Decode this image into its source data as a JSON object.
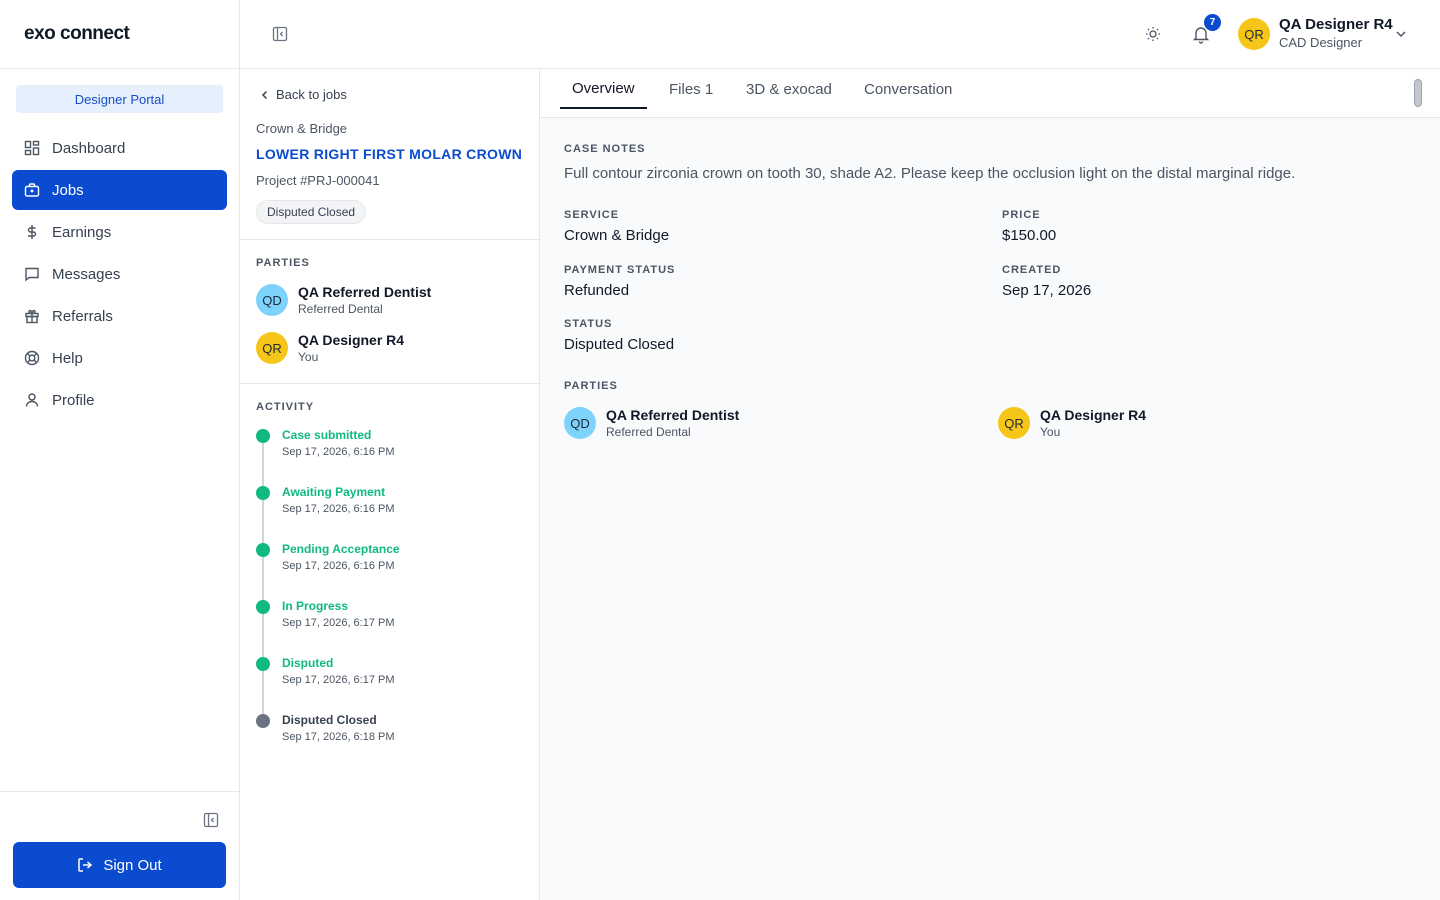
{
  "app": {
    "logo": "exo connect",
    "portal_label": "Designer Portal",
    "sign_out": "Sign Out"
  },
  "nav": [
    {
      "label": "Dashboard",
      "icon": "dashboard-icon",
      "active": false
    },
    {
      "label": "Jobs",
      "icon": "briefcase-icon",
      "active": true
    },
    {
      "label": "Earnings",
      "icon": "dollar-icon",
      "active": false
    },
    {
      "label": "Messages",
      "icon": "message-icon",
      "active": false
    },
    {
      "label": "Referrals",
      "icon": "gift-icon",
      "active": false
    },
    {
      "label": "Help",
      "icon": "lifebuoy-icon",
      "active": false
    },
    {
      "label": "Profile",
      "icon": "user-icon",
      "active": false
    }
  ],
  "header": {
    "notification_count": "7",
    "user_initials": "QR",
    "user_name": "QA Designer R4",
    "user_role": "CAD Designer"
  },
  "job": {
    "back_label": "Back to jobs",
    "category": "Crown & Bridge",
    "title": "LOWER RIGHT FIRST MOLAR CROWN",
    "project": "Project #PRJ-000041",
    "status": "Disputed Closed"
  },
  "parties_label": "PARTIES",
  "parties": [
    {
      "initials": "QD",
      "name": "QA Referred Dentist",
      "sub": "Referred Dental",
      "color": "#7dd3fc"
    },
    {
      "initials": "QR",
      "name": "QA Designer R4",
      "sub": "You",
      "color": "#f5c518"
    }
  ],
  "activity_label": "ACTIVITY",
  "activity": [
    {
      "title": "Case submitted",
      "time": "Sep 17, 2026, 6:16 PM",
      "state": "done"
    },
    {
      "title": "Awaiting Payment",
      "time": "Sep 17, 2026, 6:16 PM",
      "state": "done"
    },
    {
      "title": "Pending Acceptance",
      "time": "Sep 17, 2026, 6:16 PM",
      "state": "done"
    },
    {
      "title": "In Progress",
      "time": "Sep 17, 2026, 6:17 PM",
      "state": "done"
    },
    {
      "title": "Disputed",
      "time": "Sep 17, 2026, 6:17 PM",
      "state": "done"
    },
    {
      "title": "Disputed Closed",
      "time": "Sep 17, 2026, 6:18 PM",
      "state": "current"
    }
  ],
  "tabs": [
    {
      "label": "Overview",
      "active": true
    },
    {
      "label": "Files 1",
      "active": false
    },
    {
      "label": "3D & exocad",
      "active": false
    },
    {
      "label": "Conversation",
      "active": false
    }
  ],
  "overview": {
    "case_notes_label": "CASE NOTES",
    "case_notes": "Full contour zirconia crown on tooth 30, shade A2. Please keep the occlusion light on the distal marginal ridge.",
    "service_label": "SERVICE",
    "service": "Crown & Bridge",
    "price_label": "PRICE",
    "price": "$150.00",
    "payment_status_label": "PAYMENT STATUS",
    "payment_status": "Refunded",
    "created_label": "CREATED",
    "created": "Sep 17, 2026",
    "status_label": "STATUS",
    "status": "Disputed Closed",
    "parties_label": "PARTIES"
  },
  "colors": {
    "primary": "#0b4bcf",
    "success": "#10b981",
    "muted": "#6b7280"
  }
}
